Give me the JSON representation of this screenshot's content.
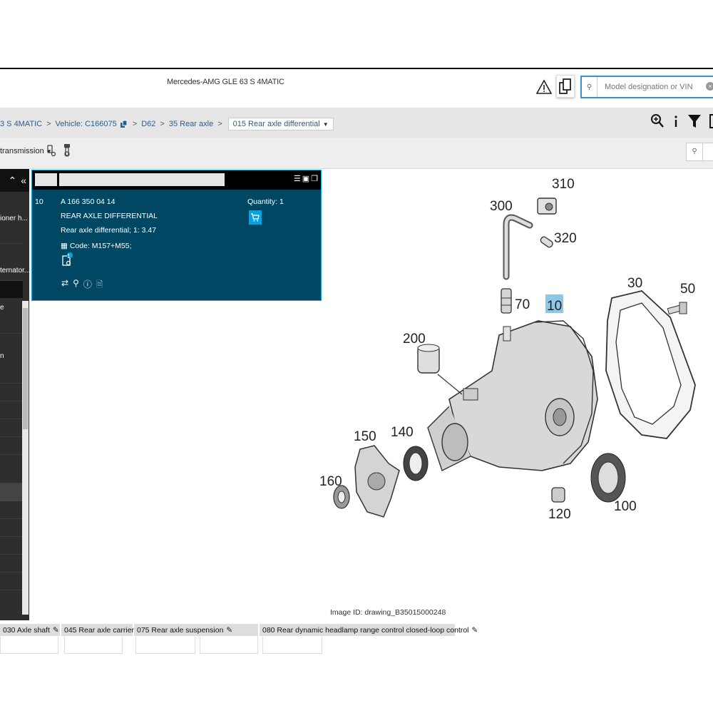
{
  "header": {
    "vehicle_title": "Mercedes-AMG GLE 63 S 4MATIC",
    "search_placeholder": "Model designation or VIN"
  },
  "breadcrumb": {
    "model": "3 S 4MATIC",
    "vehicle": "Vehicle: C166075",
    "d62": "D62",
    "group": "35 Rear axle",
    "subgroup": "015 Rear axle differential"
  },
  "toolbar": {
    "transmission_label": "transmission"
  },
  "sidebar": {
    "items": [
      "ioner h...",
      "ternator...",
      "e",
      "n"
    ]
  },
  "part_panel": {
    "position": "10",
    "part_number": "A 166 350 04 14",
    "name": "REAR AXLE DIFFERENTIAL",
    "description": "Rear axle differential; 1: 3.47",
    "code": "Code: M157+M55;",
    "quantity": "Quantity: 1",
    "badge_count": "1"
  },
  "drawing": {
    "image_id": "Image ID: drawing_B35015000248",
    "callouts": [
      "310",
      "300",
      "320",
      "30",
      "50",
      "70",
      "10",
      "200",
      "150",
      "140",
      "160",
      "120",
      "100"
    ]
  },
  "bottom_tabs": [
    "030 Axle shaft",
    "045 Rear axle carrier",
    "075 Rear axle suspension",
    "080 Rear dynamic headlamp range control closed-loop control"
  ],
  "colors": {
    "panel_bg": "#004764",
    "panel_border": "#00aee0",
    "highlight": "#8ec7e8",
    "cart_button": "#00a4e4"
  }
}
